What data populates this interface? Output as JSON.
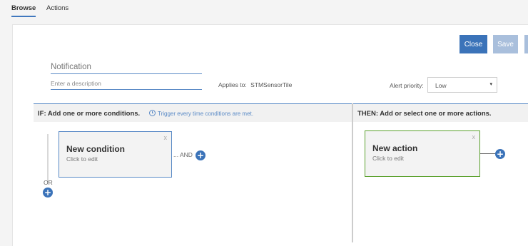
{
  "tabs": [
    {
      "label": "Browse",
      "active": true
    },
    {
      "label": "Actions",
      "active": false
    }
  ],
  "toolbar": {
    "close_label": "Close",
    "save_label": "Save"
  },
  "form": {
    "name_value": "Notification",
    "description_placeholder": "Enter a description",
    "applies_label": "Applies to:",
    "applies_value": "STMSensorTile",
    "alert_priority_label": "Alert priority:",
    "alert_priority_value": "Low"
  },
  "conditions": {
    "header": "IF: Add one or more conditions.",
    "hint": "Trigger every time conditions are met.",
    "card": {
      "title": "New condition",
      "subtitle": "Click to edit",
      "close": "x"
    },
    "and_label": "AND",
    "or_label": "OR"
  },
  "actions": {
    "header": "THEN: Add or select one or more actions.",
    "card": {
      "title": "New action",
      "subtitle": "Click to edit",
      "close": "x"
    }
  },
  "icons": {
    "add": "+",
    "dropdown": "▾"
  },
  "colors": {
    "primary": "#3b73b9",
    "primary_disabled": "#a9bfdc",
    "condition_border": "#5a8ac6",
    "action_border": "#5aa02c",
    "header_accent": "#5a8ac6"
  }
}
